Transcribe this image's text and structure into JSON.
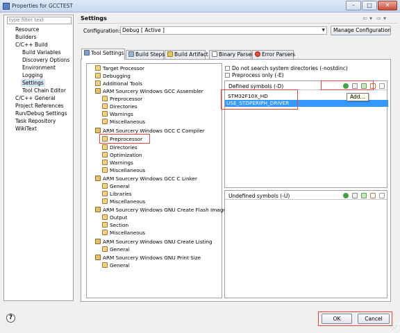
{
  "window": {
    "title": "Properties for GCCTEST",
    "minimize": "–",
    "maximize": "□",
    "close": "✕"
  },
  "left": {
    "filter_placeholder": "type filter text",
    "items": [
      "Resource",
      "Builders",
      "C/C++ Build",
      "Build Variables",
      "Discovery Options",
      "Environment",
      "Logging",
      "Settings",
      "Tool Chain Editor",
      "C/C++ General",
      "Project References",
      "Run/Debug Settings",
      "Task Repository",
      "WikiText"
    ]
  },
  "header": {
    "title": "Settings",
    "nav_back": "⇦",
    "nav_back_menu": "▾",
    "nav_forward": "⇨",
    "nav_forward_menu": "▾"
  },
  "configuration": {
    "label": "Configuration:",
    "value": "Debug  [ Active ]",
    "manage_label": "Manage Configurations..."
  },
  "tabs": [
    "Tool Settings",
    "Build Steps",
    "Build Artifact",
    "Binary Parsers",
    "Error Parsers"
  ],
  "tree": [
    "Target Processor",
    "Debugging",
    "Additional Tools",
    "ARM Sourcery Windows GCC Assembler",
    "Preprocessor",
    "Directories",
    "Warnings",
    "Miscellaneous",
    "ARM Sourcery Windows GCC C Compiler",
    "Preprocessor",
    "Directories",
    "Optimization",
    "Warnings",
    "Miscellaneous",
    "ARM Sourcery Windows GCC C Linker",
    "General",
    "Libraries",
    "Miscellaneous",
    "ARM Sourcery Windows GNU Create Flash Image",
    "Output",
    "Section",
    "Miscellaneous",
    "ARM Sourcery Windows GNU Create Listing",
    "General",
    "ARM Sourcery Windows GNU Print Size",
    "General"
  ],
  "options": {
    "nostdinc": "Do not search system directories (-nostdinc)",
    "preprocess_only": "Preprocess only (-E)"
  },
  "defined": {
    "title": "Defined symbols (-D)",
    "symbols": [
      "STM32F10X_HD",
      "USE_STDPERIPH_DRIVER"
    ],
    "tooltip": "Add..."
  },
  "undefined": {
    "title": "Undefined symbols (-U)"
  },
  "buttons": {
    "help": "?",
    "ok": "OK",
    "cancel": "Cancel"
  },
  "colors": {
    "accent": "#3399ff",
    "highlight": "#e8443a"
  }
}
